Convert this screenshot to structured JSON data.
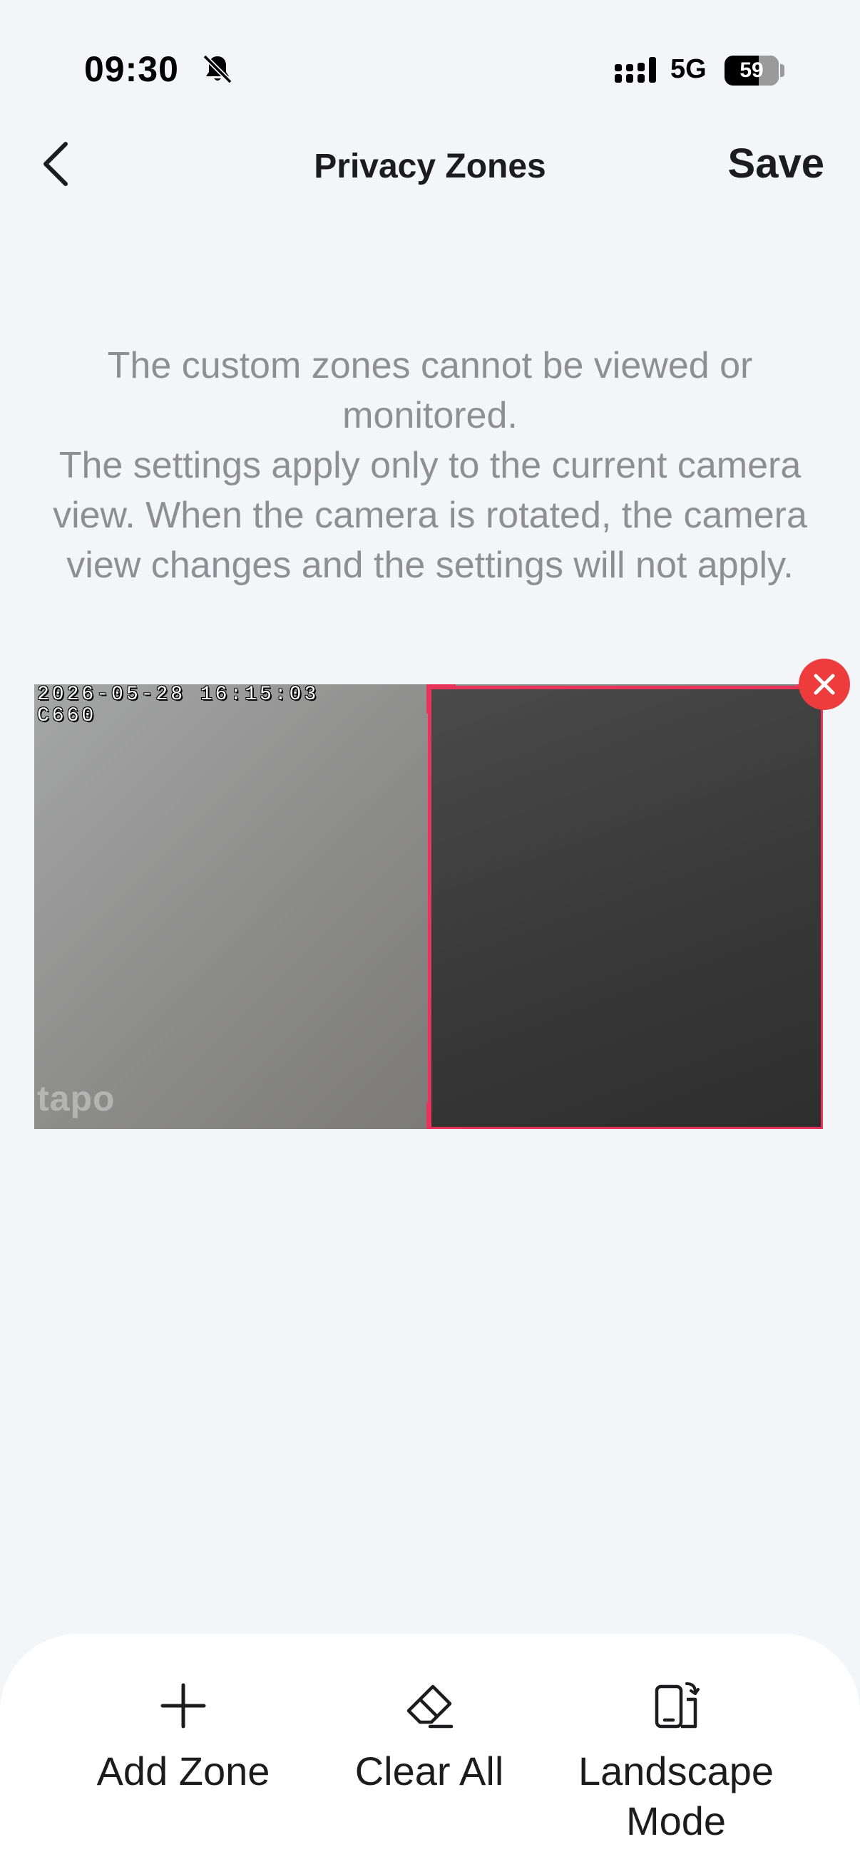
{
  "status_bar": {
    "time": "09:30",
    "network": "5G",
    "battery_level": "59"
  },
  "nav": {
    "title": "Privacy Zones",
    "save_label": "Save"
  },
  "description": {
    "line1": "The custom zones cannot be viewed or monitored.",
    "line2": "The settings apply only to the current camera view. When the camera is rotated, the camera view changes and the settings will not apply."
  },
  "camera": {
    "timestamp": "2026-05-28 16:15:03",
    "model": "C660",
    "watermark": "tapo"
  },
  "toolbar": {
    "add_zone_label": "Add Zone",
    "clear_all_label": "Clear All",
    "landscape_label": "Landscape Mode"
  },
  "colors": {
    "zone_border": "#e8335a",
    "delete_button": "#ee3b3b",
    "background": "#f4f5f9",
    "secondary_text": "#8e8e93"
  },
  "icons": {
    "back": "chevron-left-icon",
    "mute": "bell-slash-icon",
    "signal": "signal-bars-icon",
    "delete_zone": "close-icon",
    "add": "plus-icon",
    "clear": "eraser-icon",
    "landscape": "rotate-device-icon"
  }
}
